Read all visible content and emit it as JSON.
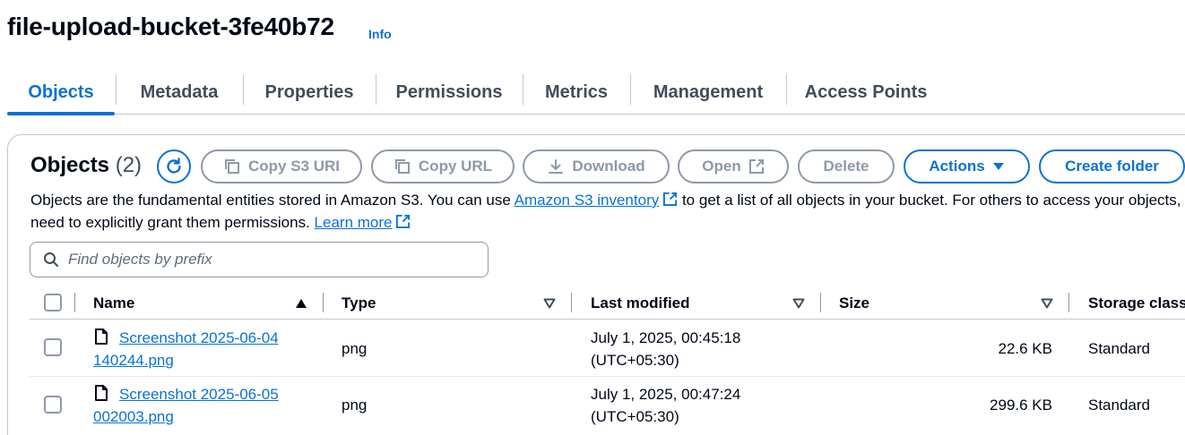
{
  "bucket": {
    "name": "file-upload-bucket-3fe40b72",
    "info_label": "Info"
  },
  "tabs": [
    {
      "label": "Objects"
    },
    {
      "label": "Metadata"
    },
    {
      "label": "Properties"
    },
    {
      "label": "Permissions"
    },
    {
      "label": "Metrics"
    },
    {
      "label": "Management"
    },
    {
      "label": "Access Points"
    }
  ],
  "objects_panel": {
    "title": "Objects",
    "count": "(2)",
    "buttons": {
      "copy_s3_uri": "Copy S3 URI",
      "copy_url": "Copy URL",
      "download": "Download",
      "open": "Open",
      "delete": "Delete",
      "actions": "Actions",
      "create_folder": "Create folder"
    },
    "description": {
      "part1": "Objects are the fundamental entities stored in Amazon S3. You can use ",
      "inventory_link": "Amazon S3 inventory",
      "part2": " to get a list of all objects in your bucket. For others to access your objects, you'll",
      "part3": "need to explicitly grant them permissions. ",
      "learn_more": "Learn more"
    },
    "search": {
      "placeholder": "Find objects by prefix",
      "value": ""
    }
  },
  "table": {
    "columns": {
      "name": "Name",
      "type": "Type",
      "last_modified": "Last modified",
      "size": "Size",
      "storage_class": "Storage class"
    },
    "rows": [
      {
        "name_line1": "Screenshot 2025-06-04",
        "name_line2": "140244.png",
        "type": "png",
        "modified_line1": "July 1, 2025, 00:45:18",
        "modified_line2": "(UTC+05:30)",
        "size": "22.6 KB",
        "storage_class": "Standard"
      },
      {
        "name_line1": "Screenshot 2025-06-05",
        "name_line2": "002003.png",
        "type": "png",
        "modified_line1": "July 1, 2025, 00:47:24",
        "modified_line2": "(UTC+05:30)",
        "size": "299.6 KB",
        "storage_class": "Standard"
      }
    ]
  },
  "colors": {
    "accent": "#0972d3",
    "disabled": "#8d99a8",
    "text": "#000716",
    "border": "#c6c6cd"
  },
  "icons": [
    "refresh-icon",
    "copy-icon",
    "download-icon",
    "external-link-icon",
    "caret-down-icon",
    "search-icon",
    "sort-ascending-icon",
    "sort-icon",
    "file-icon"
  ]
}
